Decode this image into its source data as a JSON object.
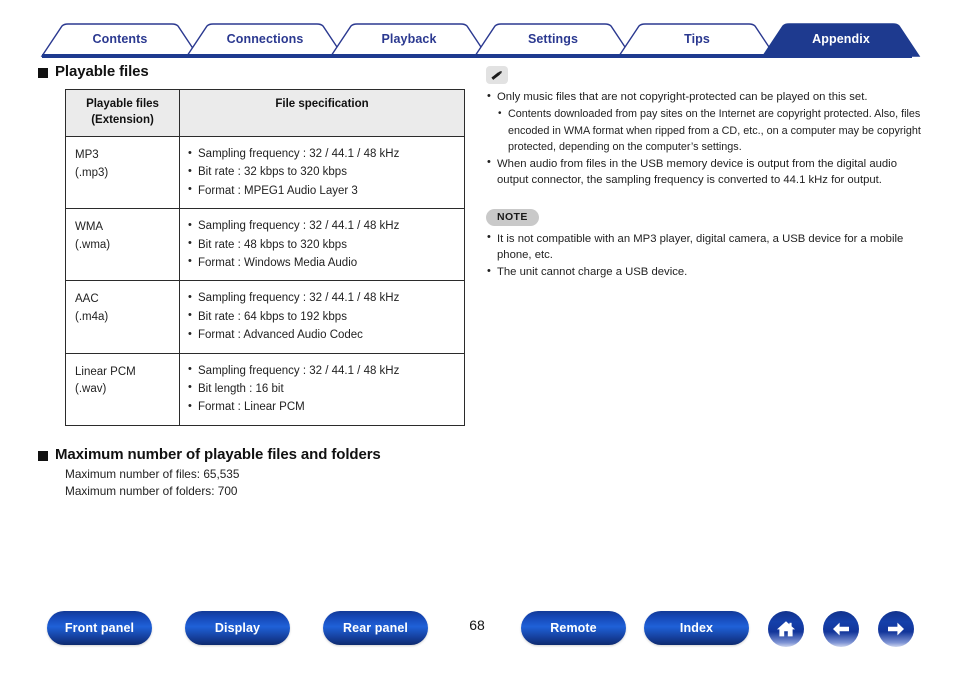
{
  "tabs": [
    {
      "label": "Contents",
      "active": false
    },
    {
      "label": "Connections",
      "active": false
    },
    {
      "label": "Playback",
      "active": false
    },
    {
      "label": "Settings",
      "active": false
    },
    {
      "label": "Tips",
      "active": false
    },
    {
      "label": "Appendix",
      "active": true
    }
  ],
  "colors": {
    "brand_blue": "#2b3990",
    "active_tab_fill": "#1e3a8f",
    "tab_underline": "#1e3a8f",
    "table_header_bg": "#ebebeb",
    "note_badge_bg": "#c9c9c9",
    "pencil_badge_bg": "#e2e2e2"
  },
  "sections": {
    "playable_files": {
      "heading": "Playable files",
      "table": {
        "headers": [
          "Playable files\n(Extension)",
          "File specification"
        ],
        "header_col1_line1": "Playable files",
        "header_col1_line2": "(Extension)",
        "header_col2": "File specification",
        "rows": [
          {
            "name": "MP3",
            "extension": "(.mp3)",
            "specs": [
              "Sampling frequency : 32 / 44.1 / 48 kHz",
              "Bit rate : 32 kbps to 320 kbps",
              "Format : MPEG1 Audio Layer 3"
            ]
          },
          {
            "name": "WMA",
            "extension": "(.wma)",
            "specs": [
              "Sampling frequency : 32 / 44.1 / 48 kHz",
              "Bit rate : 48 kbps to 320 kbps",
              "Format : Windows Media Audio"
            ]
          },
          {
            "name": "AAC",
            "extension": "(.m4a)",
            "specs": [
              "Sampling frequency : 32 / 44.1 / 48 kHz",
              "Bit rate : 64 kbps to 192 kbps",
              "Format : Advanced Audio Codec"
            ]
          },
          {
            "name": "Linear PCM",
            "extension": "(.wav)",
            "specs": [
              "Sampling frequency : 32 / 44.1 / 48 kHz",
              "Bit length : 16 bit",
              "Format : Linear PCM"
            ]
          }
        ]
      }
    },
    "maximum_number": {
      "heading": "Maximum number of playable files and folders",
      "lines": [
        "Maximum number of files: 65,535",
        "Maximum number of folders: 700"
      ]
    }
  },
  "tips_block": {
    "icon": "pencil-icon",
    "items": [
      {
        "text": "Only music files that are not copyright-protected can be played on this set.",
        "sub": [
          "Contents downloaded from pay sites on the Internet are copyright protected. Also, files encoded in WMA format when ripped from a CD, etc., on a computer may be copyright protected, depending on the computer’s settings."
        ]
      },
      {
        "text": "When audio from files in the USB memory device is output from the digital audio output connector, the sampling frequency is converted to 44.1 kHz for output.",
        "sub": []
      }
    ]
  },
  "note_block": {
    "badge": "NOTE",
    "items": [
      "It is not compatible with an MP3 player, digital camera, a USB device for a mobile phone, etc.",
      "The unit cannot charge a USB device."
    ]
  },
  "footer": {
    "buttons": [
      {
        "label": "Front panel"
      },
      {
        "label": "Display"
      },
      {
        "label": "Rear panel"
      },
      {
        "label": "Remote"
      },
      {
        "label": "Index"
      }
    ],
    "page_number": "68",
    "icons": [
      {
        "name": "home-icon"
      },
      {
        "name": "arrow-left-icon"
      },
      {
        "name": "arrow-right-icon"
      }
    ]
  }
}
